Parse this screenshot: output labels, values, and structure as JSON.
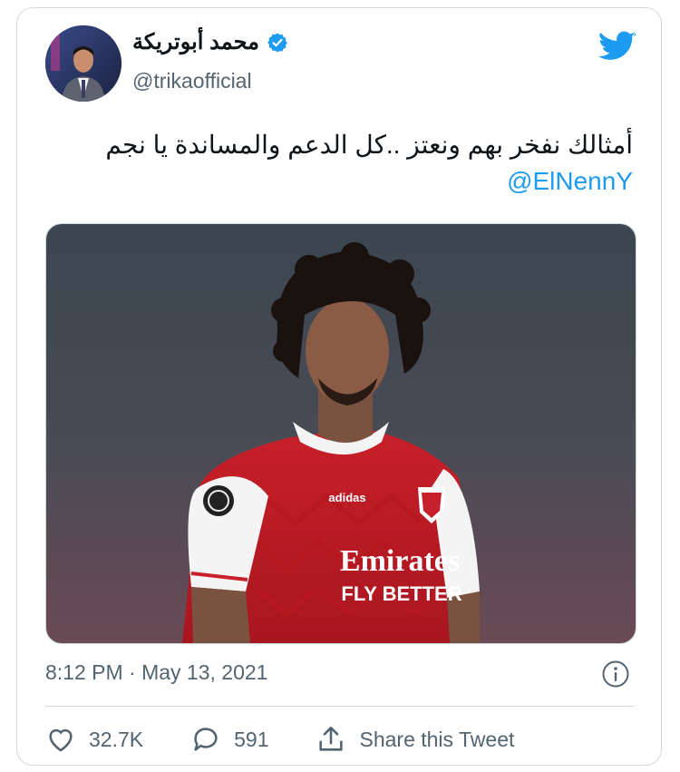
{
  "tweet": {
    "author_name": "محمد أبوتريكة",
    "handle": "@trikaofficial",
    "text": "أمثالك نفخر بهم ونعتز ..كل الدعم والمساندة يا نجم",
    "mention": "@ElNennY",
    "timestamp": "8:12 PM · May 13, 2021"
  },
  "media": {
    "jersey_sponsor_line1": "Emirates",
    "jersey_sponsor_line2": "FLY BETTER",
    "jersey_brand": "adidas"
  },
  "actions": {
    "likes": "32.7K",
    "replies": "591",
    "share_label": "Share this Tweet"
  },
  "colors": {
    "accent": "#1d9bf0",
    "muted": "#536471",
    "border": "#cfd9de"
  },
  "icons": [
    "verified-badge-icon",
    "twitter-bird-icon",
    "info-icon",
    "heart-icon",
    "reply-icon",
    "share-icon"
  ]
}
